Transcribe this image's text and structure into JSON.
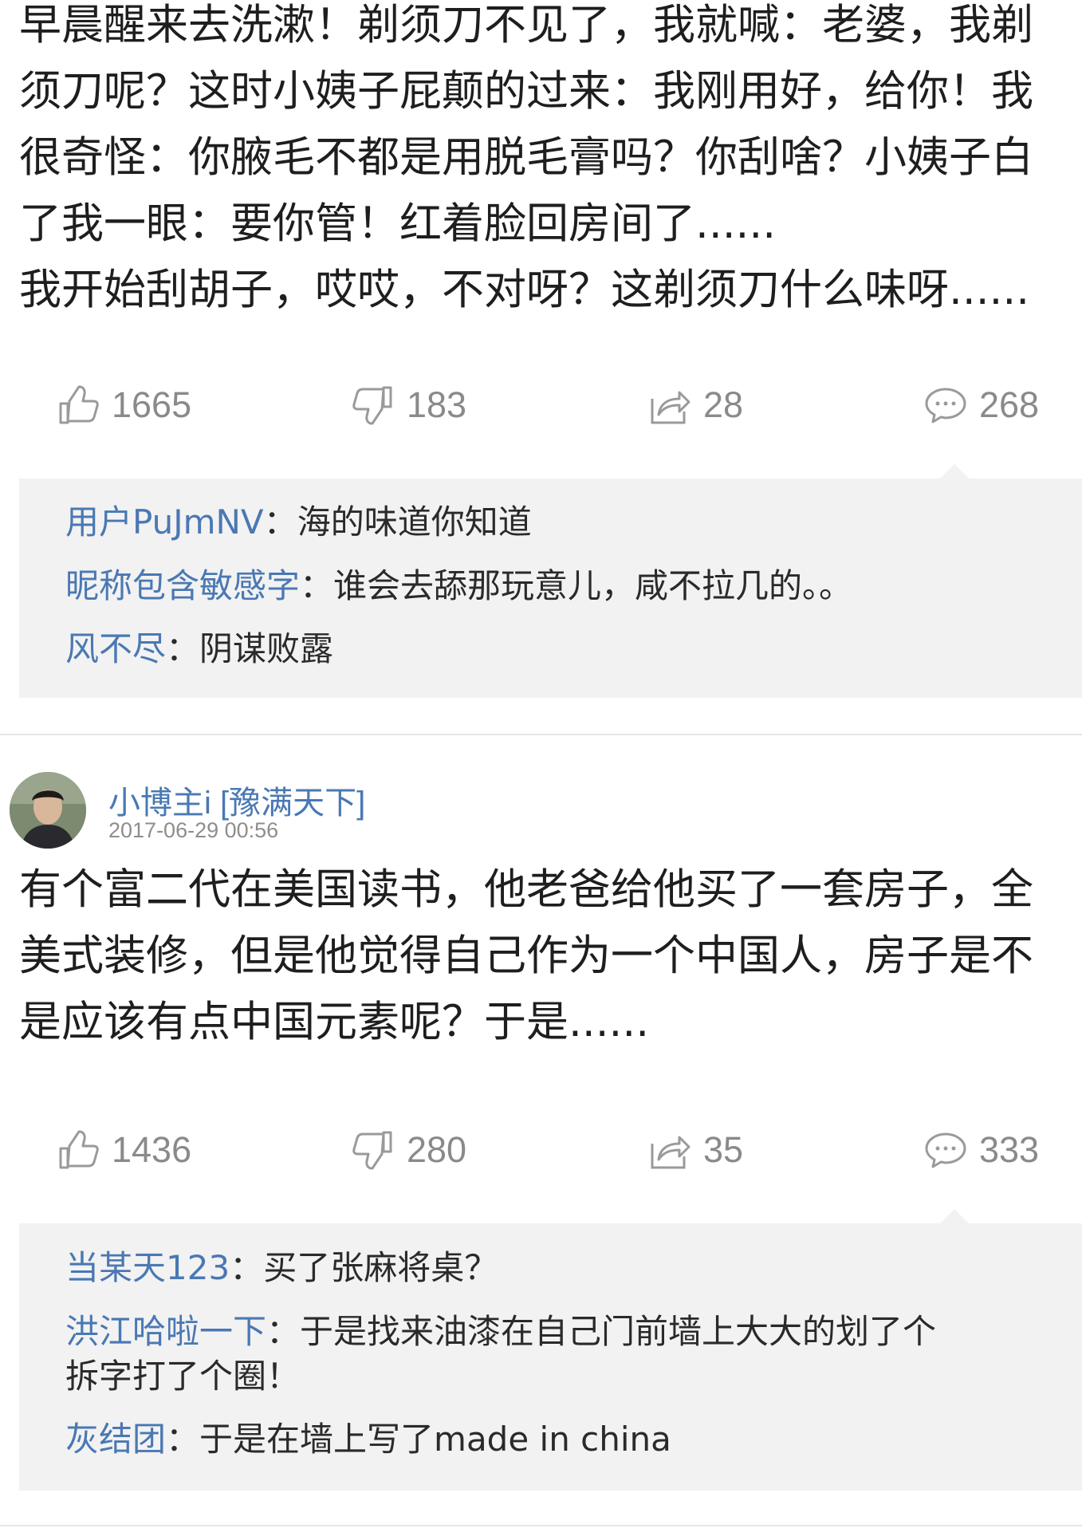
{
  "post1": {
    "lines": [
      "早晨醒来去洗漱！剃须刀不见了，我就喊：老婆，我剃",
      "须刀呢？这时小姨子屁颠的过来：我刚用好，给你！我",
      "很奇怪：你腋毛不都是用脱毛膏吗？你刮啥？小姨子白",
      "了我一眼：要你管！红着脸回房间了......",
      "我开始刮胡子，哎哎，不对呀？这剃须刀什么味呀......"
    ],
    "actions": {
      "likes": "1665",
      "dislikes": "183",
      "shares": "28",
      "comments": "268"
    },
    "comments": [
      {
        "user": "用户PuJmNV",
        "sep": "：",
        "text": "海的味道你知道"
      },
      {
        "user": "昵称包含敏感字",
        "sep": "：",
        "text": "谁会去舔那玩意儿，咸不拉几的。。"
      },
      {
        "user": "风不尽",
        "sep": "：",
        "text": "阴谋败露"
      }
    ]
  },
  "post2": {
    "author": {
      "name": "小博主i [豫满天下]",
      "time": "2017-06-29 00:56"
    },
    "lines": [
      "有个富二代在美国读书，他老爸给他买了一套房子，全",
      "美式装修，但是他觉得自己作为一个中国人，房子是不",
      "是应该有点中国元素呢？于是......"
    ],
    "actions": {
      "likes": "1436",
      "dislikes": "280",
      "shares": "35",
      "comments": "333"
    },
    "comments": [
      {
        "user": "当某天123",
        "sep": "：",
        "text": "买了张麻将桌？",
        "text2": ""
      },
      {
        "user": "洪江哈啦一下",
        "sep": "：",
        "text": "于是找来油漆在自己门前墙上大大的划了个",
        "text2": "拆字打了个圈！"
      },
      {
        "user": "灰结团",
        "sep": "：",
        "text": "于是在墙上写了made in china",
        "text2": ""
      }
    ]
  },
  "icons": [
    "thumbs-up-icon",
    "thumbs-down-icon",
    "share-icon",
    "comment-bubble-icon"
  ],
  "colors": {
    "link": "#4a78b3",
    "count": "#8a8a8a",
    "comment_bg": "#f2f2f2"
  }
}
